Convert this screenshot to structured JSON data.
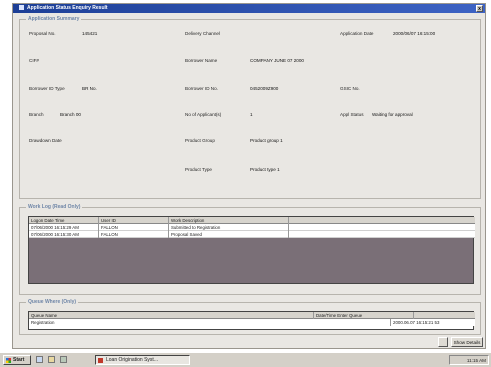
{
  "window": {
    "title": "Application Status Enquiry Result",
    "close_label": "x"
  },
  "app_summary": {
    "legend": "Application Summary",
    "proposal_no_label": "Proposal No.",
    "proposal_no": "145421",
    "delivery_channel_label": "Delivery Channel",
    "delivery_channel": "",
    "application_date_label": "Application Date",
    "application_date": "2000/06/07 16:15:00",
    "cif_label": "CIF#",
    "cif": "",
    "borrower_name_label": "Borrower Name",
    "borrower_name": "COMPANY JUNE 07 2000",
    "borrower_id_type_label": "Borrower ID Type",
    "borrower_id_type": "BR No.",
    "borrower_id_no_label": "Borrower ID No.",
    "borrower_id_no": "0452009Z900",
    "gsic_label": "GSIC No.",
    "gsic": "",
    "branch_label": "Branch",
    "branch": "Branch 00",
    "no_applicants_label": "No of Applicant(s)",
    "no_applicants": "1",
    "appl_status_label": "Appl Status",
    "appl_status": "Waiting for approval",
    "drawdown_label": "Drawdown Date",
    "drawdown": "",
    "product_group_label": "Product Group",
    "product_group": "Product group 1",
    "product_type_label": "Product Type",
    "product_type": "Product type 1"
  },
  "work_log": {
    "legend": "Work Log (Read Only)",
    "headers": [
      "Logon Date Time",
      "User ID",
      "Work Description"
    ],
    "rows": [
      [
        "07/06/2000 16:15:29 AM",
        "FALLON",
        "Submitted to Registration"
      ],
      [
        "07/06/2000 16:15:30 AM",
        "FALLON",
        "Proposal Saved"
      ]
    ]
  },
  "queue": {
    "legend": "Queue Where (Only)",
    "headers": [
      "Queue Name",
      "Date/Time Enter Queue"
    ],
    "rows": [
      [
        "Registration",
        "2000.06.07 16:15:21 53"
      ]
    ]
  },
  "buttons": {
    "small_label": "",
    "show_details": "Show Details"
  },
  "taskbar": {
    "start_label": "Start",
    "task_label": "Loan Origination Syst...",
    "clock": "11:15 AM"
  }
}
